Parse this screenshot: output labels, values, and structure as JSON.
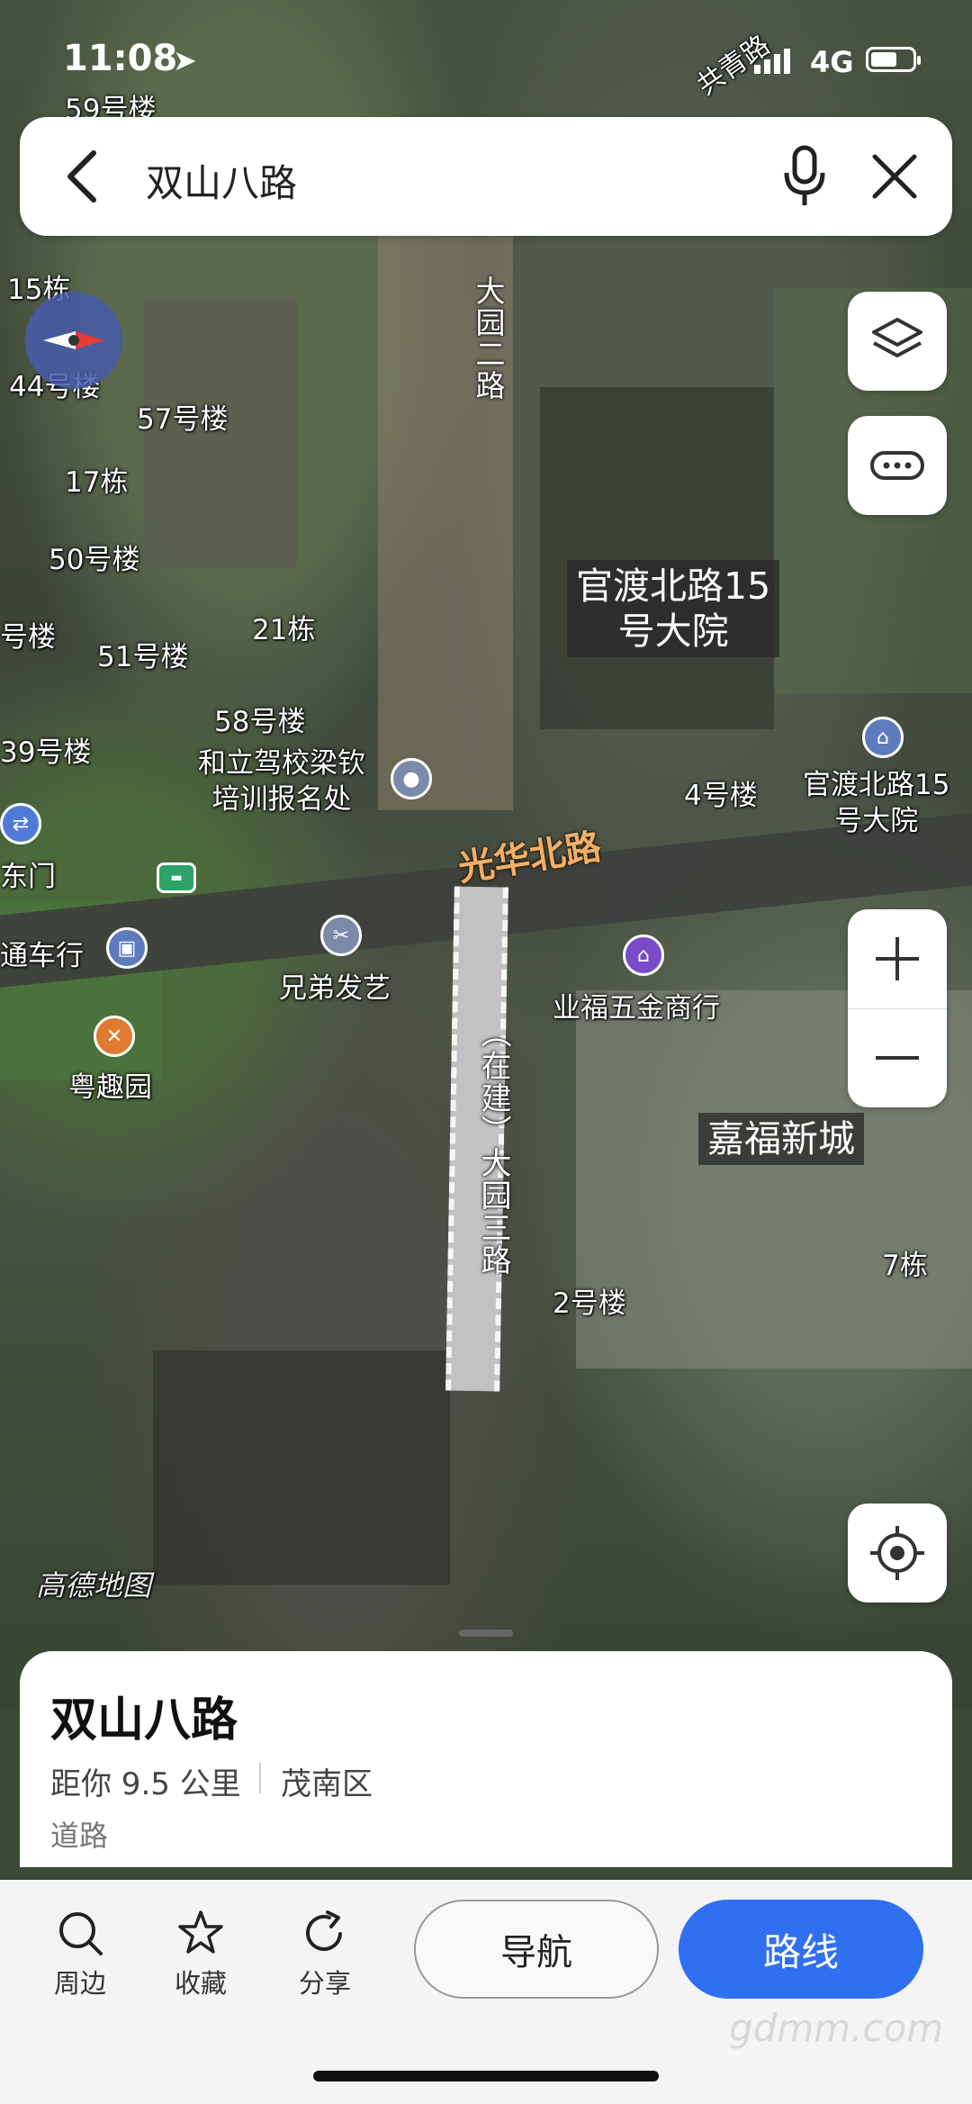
{
  "status_bar": {
    "time": "11:08",
    "network": "4G"
  },
  "search": {
    "query": "双山八路"
  },
  "map": {
    "watermark": "高德地图",
    "road_highlight_label": "光华北路",
    "construction_road_label": "（在建）大园三路",
    "road_vertical_label": "大园二路",
    "corner_road_label": "共青路",
    "boxed_labels": [
      "官渡北路15\n号大院",
      "嘉福新城"
    ],
    "labels": [
      "59号楼",
      "15栋",
      "44号楼",
      "57号楼",
      "17栋",
      "50号楼",
      "号楼",
      "21栋",
      "51号楼",
      "58号楼",
      "39号楼",
      "和立驾校梁钦\n培训报名处",
      "4号楼",
      "官渡北路15\n号大院",
      "东门",
      "通车行",
      "兄弟发艺",
      "业福五金商行",
      "粤趣园",
      "7栋",
      "2号楼"
    ]
  },
  "place_card": {
    "name": "双山八路",
    "distance": "距你 9.5 公里",
    "district": "茂南区",
    "category": "道路"
  },
  "toolbar": {
    "nearby": "周边",
    "favorite": "收藏",
    "share": "分享",
    "navigate": "导航",
    "route": "路线"
  },
  "watermark_site": "gdmm.com",
  "colors": {
    "accent": "#2f6ff0",
    "road_label": "#f0b068"
  }
}
